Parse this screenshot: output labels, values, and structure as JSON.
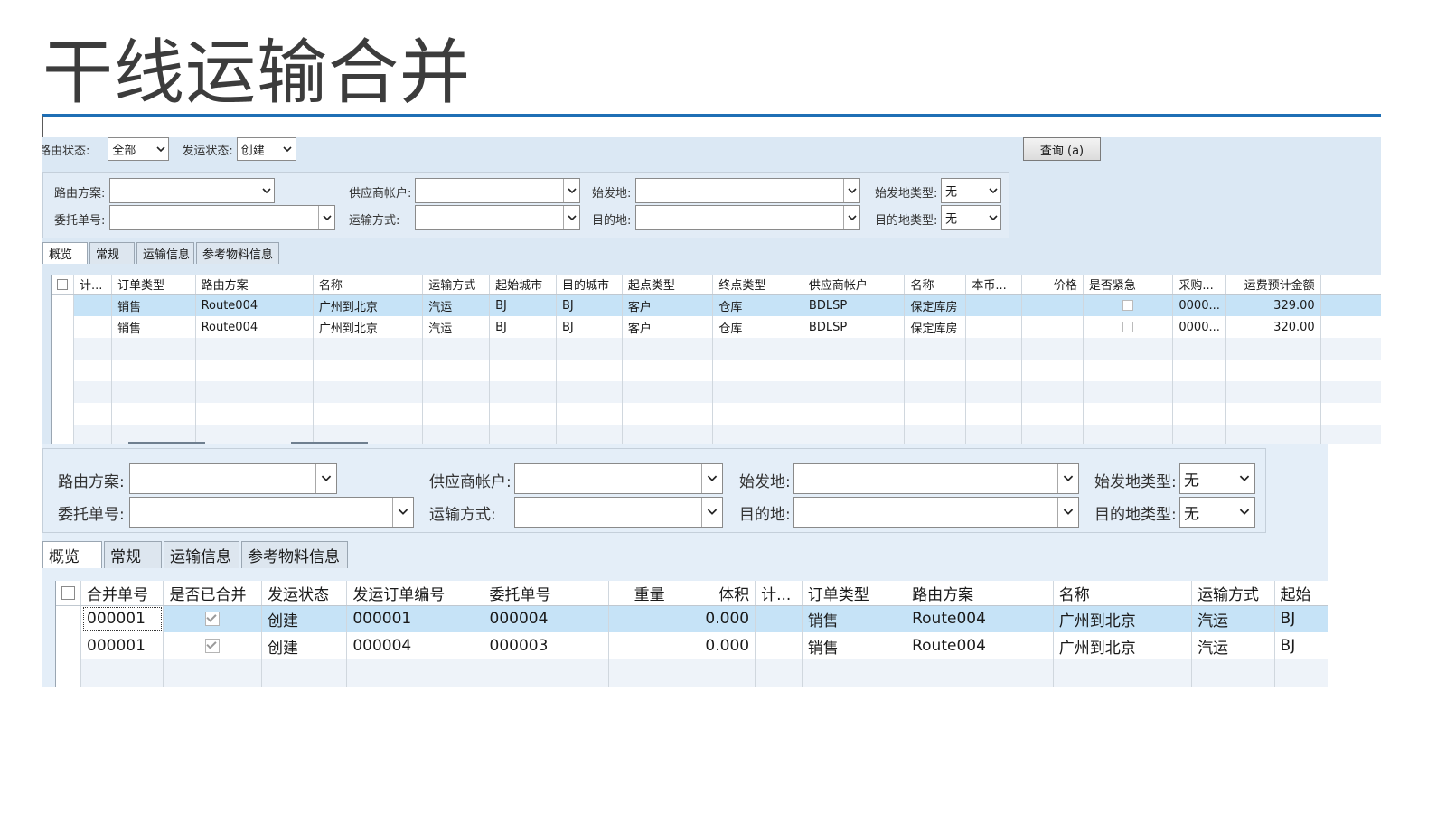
{
  "slide": {
    "title": "干线运输合并"
  },
  "panel1": {
    "route_status_label": "路由状态:",
    "route_status_value": "全部",
    "ship_status_label": "发运状态:",
    "ship_status_value": "创建",
    "query_button": "查询 (a)",
    "filters": {
      "route_plan_label": "路由方案:",
      "route_plan_value": "",
      "vendor_label": "供应商帐户:",
      "vendor_value": "",
      "origin_label": "始发地:",
      "origin_value": "",
      "origin_type_label": "始发地类型:",
      "origin_type_value": "无",
      "order_no_label": "委托单号:",
      "order_no_value": "",
      "transport_label": "运输方式:",
      "transport_value": "",
      "dest_label": "目的地:",
      "dest_value": "",
      "dest_type_label": "目的地类型:",
      "dest_type_value": "无"
    },
    "tabs": [
      "概览",
      "常规",
      "运输信息",
      "参考物料信息"
    ],
    "columns": [
      "计...",
      "订单类型",
      "路由方案",
      "名称",
      "运输方式",
      "起始城市",
      "目的城市",
      "起点类型",
      "终点类型",
      "供应商帐户",
      "名称",
      "本币...",
      "价格",
      "是否紧急",
      "采购...",
      "运费预计金额"
    ],
    "rows": [
      [
        "",
        "销售",
        "Route004",
        "广州到北京",
        "汽运",
        "BJ",
        "BJ",
        "客户",
        "仓库",
        "BDLSP",
        "保定库房",
        "",
        "",
        "",
        "0000...",
        "329.00"
      ],
      [
        "",
        "销售",
        "Route004",
        "广州到北京",
        "汽运",
        "BJ",
        "BJ",
        "客户",
        "仓库",
        "BDLSP",
        "保定库房",
        "",
        "",
        "",
        "0000...",
        "320.00"
      ]
    ]
  },
  "panel2": {
    "filters": {
      "route_plan_label": "路由方案:",
      "route_plan_value": "",
      "vendor_label": "供应商帐户:",
      "vendor_value": "",
      "origin_label": "始发地:",
      "origin_value": "",
      "origin_type_label": "始发地类型:",
      "origin_type_value": "无",
      "order_no_label": "委托单号:",
      "order_no_value": "",
      "transport_label": "运输方式:",
      "transport_value": "",
      "dest_label": "目的地:",
      "dest_value": "",
      "dest_type_label": "目的地类型:",
      "dest_type_value": "无"
    },
    "tabs": [
      "概览",
      "常规",
      "运输信息",
      "参考物料信息"
    ],
    "columns": [
      "合并单号",
      "是否已合并",
      "发运状态",
      "发运订单编号",
      "委托单号",
      "重量",
      "体积",
      "计...",
      "订单类型",
      "路由方案",
      "名称",
      "运输方式",
      "起始"
    ],
    "rows": [
      [
        "000001",
        "",
        "创建",
        "000001",
        "000004",
        "",
        "0.000",
        "",
        "销售",
        "Route004",
        "广州到北京",
        "汽运",
        "BJ"
      ],
      [
        "000001",
        "",
        "创建",
        "000004",
        "000003",
        "",
        "0.000",
        "",
        "销售",
        "Route004",
        "广州到北京",
        "汽运",
        "BJ"
      ]
    ]
  }
}
